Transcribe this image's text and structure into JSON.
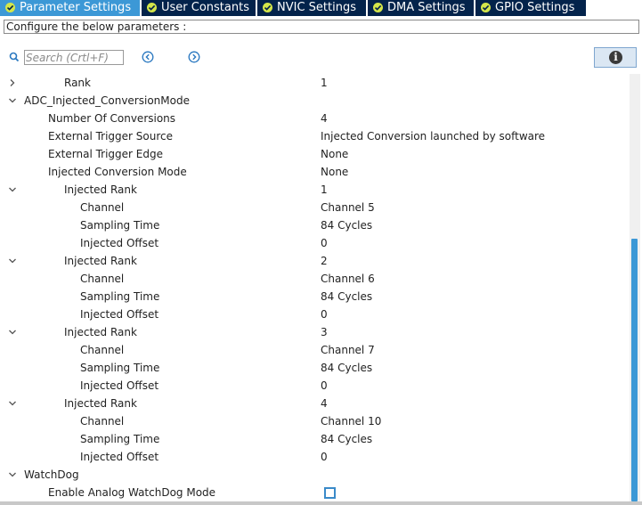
{
  "tabs": [
    {
      "label": "Parameter Settings",
      "active": true
    },
    {
      "label": "User Constants",
      "active": false
    },
    {
      "label": "NVIC Settings",
      "active": false
    },
    {
      "label": "DMA Settings",
      "active": false
    },
    {
      "label": "GPIO Settings",
      "active": false
    }
  ],
  "description": "Configure the below parameters :",
  "toolbar": {
    "search_placeholder": "Search (Crtl+F)",
    "prev_icon": "circle-arrow-left-icon",
    "next_icon": "circle-arrow-right-icon",
    "info_icon": "info-icon"
  },
  "tree": [
    {
      "name": "Rank",
      "value": "1",
      "level": 2,
      "arrow": "collapsed"
    },
    {
      "name": "ADC_Injected_ConversionMode",
      "value": "",
      "level": 0,
      "arrow": "expanded"
    },
    {
      "name": "Number Of Conversions",
      "value": "4",
      "level": 1
    },
    {
      "name": "External Trigger Source",
      "value": "Injected Conversion launched by software",
      "level": 1
    },
    {
      "name": "External Trigger Edge",
      "value": "None",
      "level": 1
    },
    {
      "name": "Injected Conversion Mode",
      "value": "None",
      "level": 1
    },
    {
      "name": "Injected Rank",
      "value": "1",
      "level": 2,
      "arrow": "expanded"
    },
    {
      "name": "Channel",
      "value": "Channel 5",
      "level": 3
    },
    {
      "name": "Sampling Time",
      "value": "84 Cycles",
      "level": 3
    },
    {
      "name": "Injected Offset",
      "value": "0",
      "level": 3
    },
    {
      "name": "Injected Rank",
      "value": "2",
      "level": 2,
      "arrow": "expanded"
    },
    {
      "name": "Channel",
      "value": "Channel 6",
      "level": 3
    },
    {
      "name": "Sampling Time",
      "value": "84 Cycles",
      "level": 3
    },
    {
      "name": "Injected Offset",
      "value": "0",
      "level": 3
    },
    {
      "name": "Injected Rank",
      "value": "3",
      "level": 2,
      "arrow": "expanded"
    },
    {
      "name": "Channel",
      "value": "Channel 7",
      "level": 3
    },
    {
      "name": "Sampling Time",
      "value": "84 Cycles",
      "level": 3
    },
    {
      "name": "Injected Offset",
      "value": "0",
      "level": 3
    },
    {
      "name": "Injected Rank",
      "value": "4",
      "level": 2,
      "arrow": "expanded"
    },
    {
      "name": "Channel",
      "value": "Channel 10",
      "level": 3
    },
    {
      "name": "Sampling Time",
      "value": "84 Cycles",
      "level": 3
    },
    {
      "name": "Injected Offset",
      "value": "0",
      "level": 3
    },
    {
      "name": "WatchDog",
      "value": "",
      "level": 0,
      "arrow": "expanded"
    },
    {
      "name": "Enable Analog WatchDog Mode",
      "value": "",
      "level": 1,
      "checkbox": true
    }
  ],
  "colors": {
    "tab_bg": "#03234b",
    "tab_active": "#3c98d6",
    "check": "#d4e64a",
    "scroll_thumb": "#3c98d6"
  }
}
